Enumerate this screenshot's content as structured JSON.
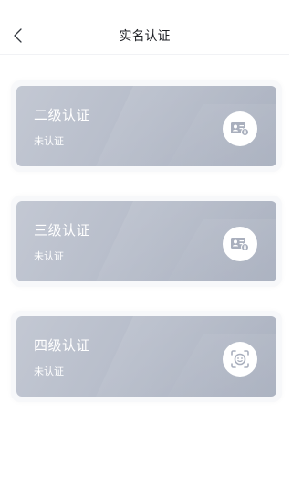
{
  "header": {
    "title": "实名认证",
    "back_icon": "chevron-left-icon"
  },
  "colors": {
    "card_gradient_start": "#c3c8d3",
    "card_gradient_end": "#a8afbe",
    "icon_color": "#a9afbd"
  },
  "cards": [
    {
      "level": "二级认证",
      "status": "未认证",
      "icon": "id-card-lock-icon"
    },
    {
      "level": "三级认证",
      "status": "未认证",
      "icon": "id-card-lock-icon"
    },
    {
      "level": "四级认证",
      "status": "未认证",
      "icon": "face-scan-icon"
    }
  ]
}
